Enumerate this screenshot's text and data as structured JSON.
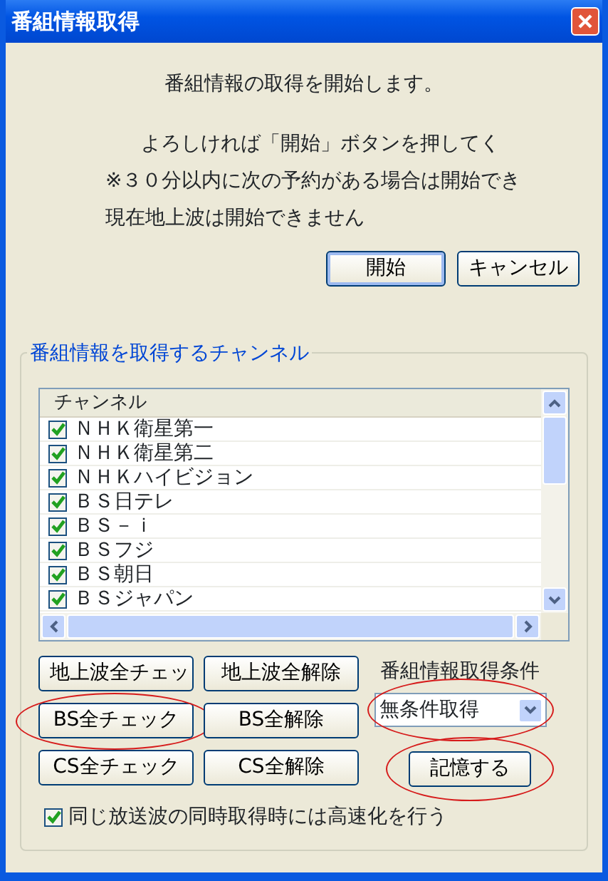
{
  "window": {
    "title": "番組情報取得"
  },
  "messages": [
    {
      "text": "番組情報の取得を開始します。",
      "kind": "center"
    },
    {
      "text": "よろしければ「開始」ボタンを押してく",
      "kind": "indent"
    },
    {
      "text": "※３０分以内に次の予約がある場合は開始でき",
      "kind": "left"
    },
    {
      "text": "現在地上波は開始できません",
      "kind": "left"
    }
  ],
  "dialog_buttons": [
    {
      "label": "開始",
      "default": true
    },
    {
      "label": "キャンセル",
      "default": false
    }
  ],
  "channel_group": {
    "legend": "番組情報を取得するチャンネル",
    "column": "チャンネル",
    "channels": [
      {
        "name": "ＮＨＫ衛星第一",
        "checked": true
      },
      {
        "name": "ＮＨＫ衛星第二",
        "checked": true
      },
      {
        "name": "ＮＨＫハイビジョン",
        "checked": true
      },
      {
        "name": "ＢＳ日テレ",
        "checked": true
      },
      {
        "name": "ＢＳ－ｉ",
        "checked": true
      },
      {
        "name": "ＢＳフジ",
        "checked": true
      },
      {
        "name": "ＢＳ朝日",
        "checked": true
      },
      {
        "name": "ＢＳジャパン",
        "checked": true
      }
    ]
  },
  "select_buttons": [
    {
      "label": "地上波全チェッ",
      "circled": false
    },
    {
      "label": "地上波全解除",
      "circled": false
    },
    {
      "label": "BS全チェック",
      "circled": true
    },
    {
      "label": "BS全解除",
      "circled": false
    },
    {
      "label": "CS全チェック",
      "circled": false
    },
    {
      "label": "CS全解除",
      "circled": false
    }
  ],
  "condition": {
    "label": "番組情報取得条件",
    "value": "無条件取得",
    "circled": true
  },
  "save_button": {
    "label": "記憶する",
    "circled": true
  },
  "speedup": {
    "label": "同じ放送波の同時取得時には高速化を行う",
    "checked": true
  }
}
